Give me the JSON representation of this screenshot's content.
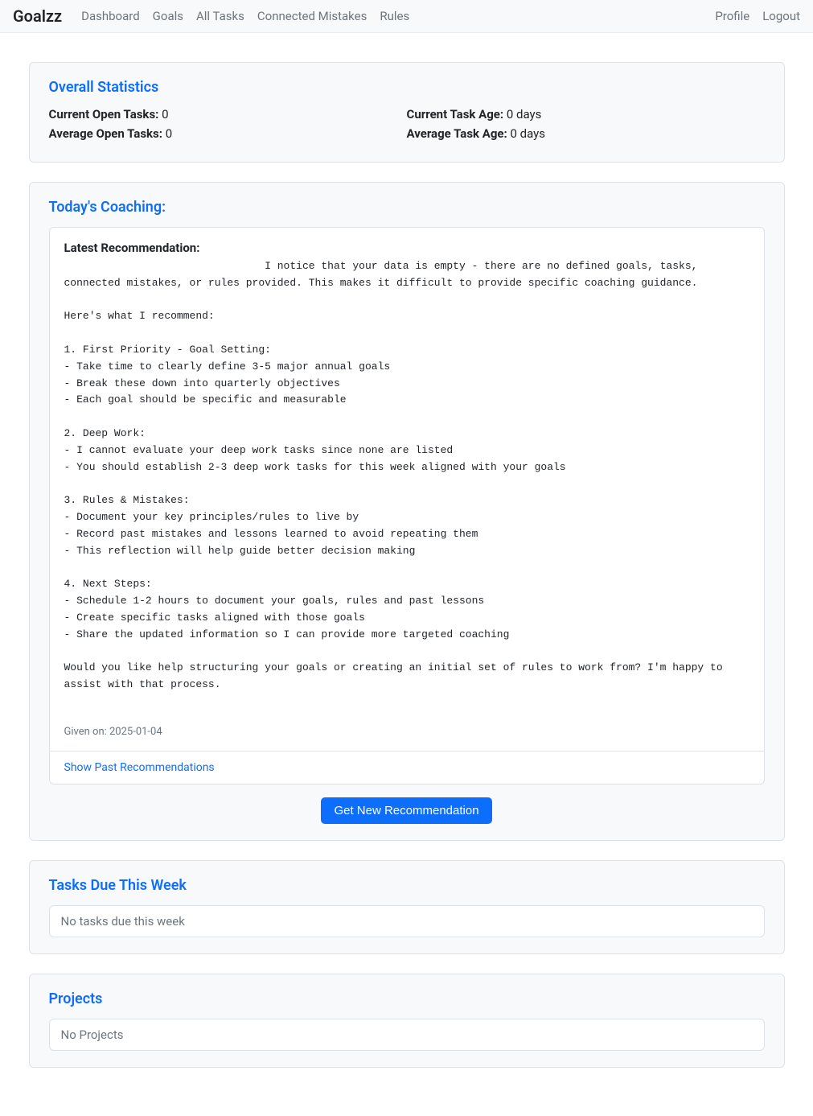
{
  "navbar": {
    "brand": "Goalzz",
    "links": [
      "Dashboard",
      "Goals",
      "All Tasks",
      "Connected Mistakes",
      "Rules"
    ],
    "right": [
      "Profile",
      "Logout"
    ]
  },
  "stats": {
    "title": "Overall Statistics",
    "current_open_label": "Current Open Tasks:",
    "current_open_value": " 0",
    "avg_open_label": "Average Open Tasks:",
    "avg_open_value": " 0",
    "current_age_label": "Current Task Age:",
    "current_age_value": " 0 days",
    "avg_age_label": "Average Task Age:",
    "avg_age_value": " 0 days"
  },
  "coaching": {
    "title": "Today's Coaching:",
    "latest_label": "Latest Recommendation:",
    "body": "                                I notice that your data is empty - there are no defined goals, tasks, connected mistakes, or rules provided. This makes it difficult to provide specific coaching guidance.\n\nHere's what I recommend:\n\n1. First Priority - Goal Setting:\n- Take time to clearly define 3-5 major annual goals\n- Break these down into quarterly objectives\n- Each goal should be specific and measurable\n\n2. Deep Work:\n- I cannot evaluate your deep work tasks since none are listed\n- You should establish 2-3 deep work tasks for this week aligned with your goals\n\n3. Rules & Mistakes:\n- Document your key principles/rules to live by\n- Record past mistakes and lessons learned to avoid repeating them\n- This reflection will help guide better decision making\n\n4. Next Steps:\n- Schedule 1-2 hours to document your goals, rules and past lessons\n- Create specific tasks aligned with those goals\n- Share the updated information so I can provide more targeted coaching\n\nWould you like help structuring your goals or creating an initial set of rules to work from? I'm happy to assist with that process.",
    "given_on_label": "Given on: ",
    "given_on_value": "2025-01-04",
    "show_past": "Show Past Recommendations",
    "get_new": "Get New Recommendation"
  },
  "tasks_week": {
    "title": "Tasks Due This Week",
    "empty": "No tasks due this week"
  },
  "projects": {
    "title": "Projects",
    "empty": "No Projects"
  }
}
